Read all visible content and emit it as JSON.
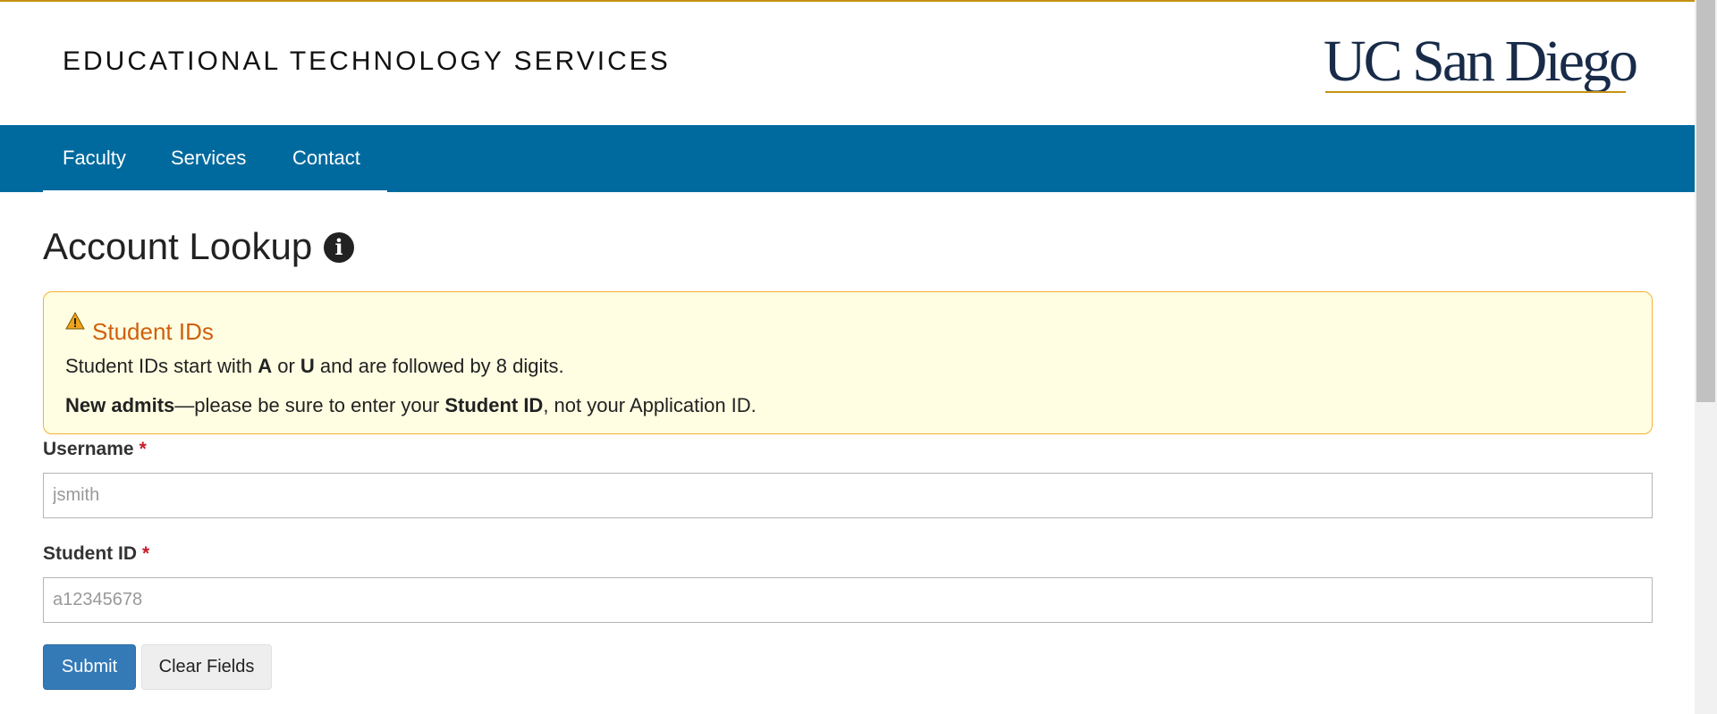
{
  "header": {
    "site_title": "EDUCATIONAL TECHNOLOGY SERVICES",
    "logo_text": "UC San Diego"
  },
  "nav": {
    "items": [
      {
        "label": "Faculty"
      },
      {
        "label": "Services"
      },
      {
        "label": "Contact"
      }
    ]
  },
  "main": {
    "title": "Account Lookup",
    "info_icon": "info-icon"
  },
  "alert": {
    "icon": "warning-icon",
    "title": "Student IDs",
    "line1": {
      "t1": "Student IDs start with ",
      "b1": "A",
      "t2": " or ",
      "b2": "U",
      "t3": " and are followed by 8 digits."
    },
    "line2": {
      "b1": "New admits",
      "t1": "—please be sure to enter your ",
      "b2": "Student ID",
      "t2": ", not your Application ID."
    }
  },
  "form": {
    "username": {
      "label": "Username",
      "required_mark": "*",
      "placeholder": "jsmith",
      "value": ""
    },
    "student_id": {
      "label": "Student ID",
      "required_mark": "*",
      "placeholder": "a12345678",
      "value": ""
    },
    "submit_label": "Submit",
    "clear_label": "Clear Fields"
  },
  "colors": {
    "accent_gold": "#c69214",
    "nav_blue": "#006a9e",
    "logo_navy": "#182b49",
    "alert_title": "#d15f0c",
    "primary_button": "#337ab7"
  }
}
